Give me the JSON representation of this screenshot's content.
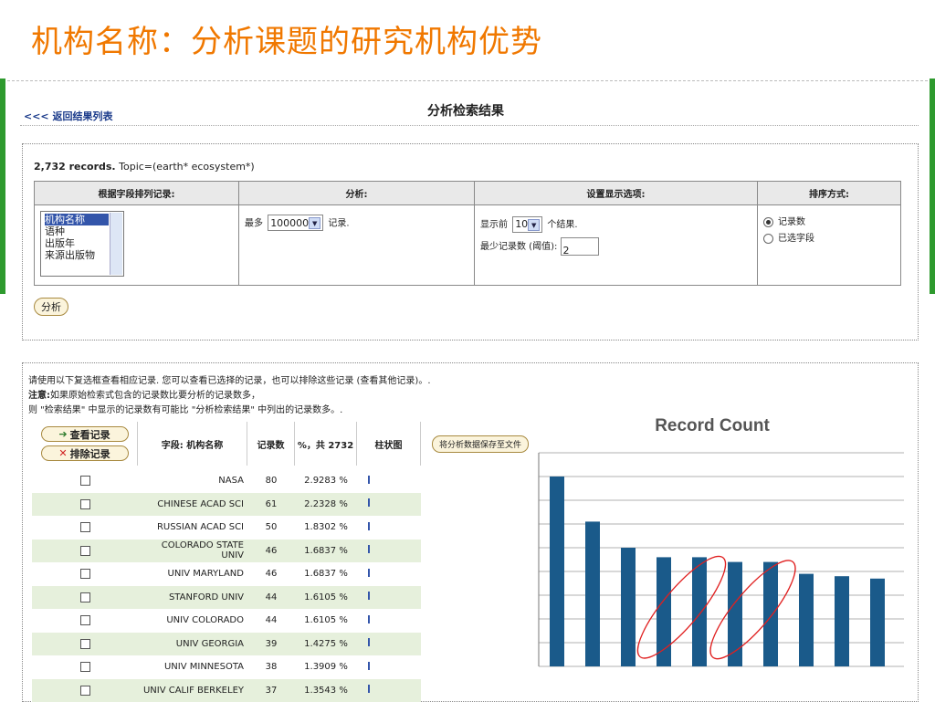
{
  "slide": {
    "title": "机构名称：分析课题的研究机构优势"
  },
  "header": {
    "back_link": "<<< 返回结果列表",
    "title": "分析检索结果"
  },
  "summary": {
    "records": "2,732 records.",
    "topic": "Topic=(earth* ecosystem*)"
  },
  "options": {
    "col_rank_field": "根据字段排列记录:",
    "col_analyze": "分析:",
    "col_display": "设置显示选项:",
    "col_sort": "排序方式:",
    "field_list": [
      "机构名称",
      "语种",
      "出版年",
      "来源出版物"
    ],
    "max_prefix": "最多",
    "max_value": "100000",
    "max_suffix": "记录.",
    "show_prefix": "显示前",
    "show_value": "10",
    "show_suffix": "个结果.",
    "min_label": "最少记录数 (阈值):",
    "min_value": "2",
    "sort_options": [
      "记录数",
      "已选字段"
    ],
    "analyze_button": "分析"
  },
  "notes": {
    "line1": "请使用以下复选框查看相应记录. 您可以查看已选择的记录，也可以排除这些记录 (查看其他记录)。.",
    "line2_label": "注意:",
    "line2": "如果原始检索式包含的记录数比要分析的记录数多，",
    "line3": "则 \"检索结果\" 中显示的记录数有可能比 \"分析检索结果\" 中列出的记录数多。."
  },
  "results_header": {
    "view_records": "查看记录",
    "exclude_records": "排除记录",
    "field_col": "字段: 机构名称",
    "count_col": "记录数",
    "pct_col": "%，共 2732",
    "bar_col": "柱状图",
    "save_button": "将分析数据保存至文件"
  },
  "results": [
    {
      "name": "NASA",
      "count": "80",
      "pct": "2.9283 %"
    },
    {
      "name": "CHINESE ACAD SCI",
      "count": "61",
      "pct": "2.2328 %"
    },
    {
      "name": "RUSSIAN ACAD SCI",
      "count": "50",
      "pct": "1.8302 %"
    },
    {
      "name": "COLORADO STATE UNIV",
      "count": "46",
      "pct": "1.6837 %"
    },
    {
      "name": "UNIV MARYLAND",
      "count": "46",
      "pct": "1.6837 %"
    },
    {
      "name": "STANFORD UNIV",
      "count": "44",
      "pct": "1.6105 %"
    },
    {
      "name": "UNIV COLORADO",
      "count": "44",
      "pct": "1.6105 %"
    },
    {
      "name": "UNIV GEORGIA",
      "count": "39",
      "pct": "1.4275 %"
    },
    {
      "name": "UNIV MINNESOTA",
      "count": "38",
      "pct": "1.3909 %"
    },
    {
      "name": "UNIV CALIF BERKELEY",
      "count": "37",
      "pct": "1.3543 %"
    }
  ],
  "chart_data": {
    "type": "bar",
    "title": "Record Count",
    "categories": [
      "NASA",
      "CHINESE ACAD SCI",
      "RUSSIAN ACAD SCI",
      "COLORADO STATE UNIV",
      "UNIV MARYLAND",
      "STANFORD UNIV",
      "UNIV COLORADO",
      "UNIV GEORGIA",
      "UNIV MINNESOTA",
      "UNIV CALIF BERKELEY"
    ],
    "values": [
      80,
      61,
      50,
      46,
      46,
      44,
      44,
      39,
      38,
      37
    ],
    "ylim": [
      0,
      90
    ],
    "grid": true,
    "bar_color": "#1a5a8a",
    "annotation_color": "#e02020",
    "highlighted_groups": [
      [
        3,
        4
      ],
      [
        5,
        6
      ]
    ]
  },
  "colors": {
    "title": "#f07800",
    "accent_green": "#2e9a2e",
    "row_alt": "#e6f0dc"
  }
}
